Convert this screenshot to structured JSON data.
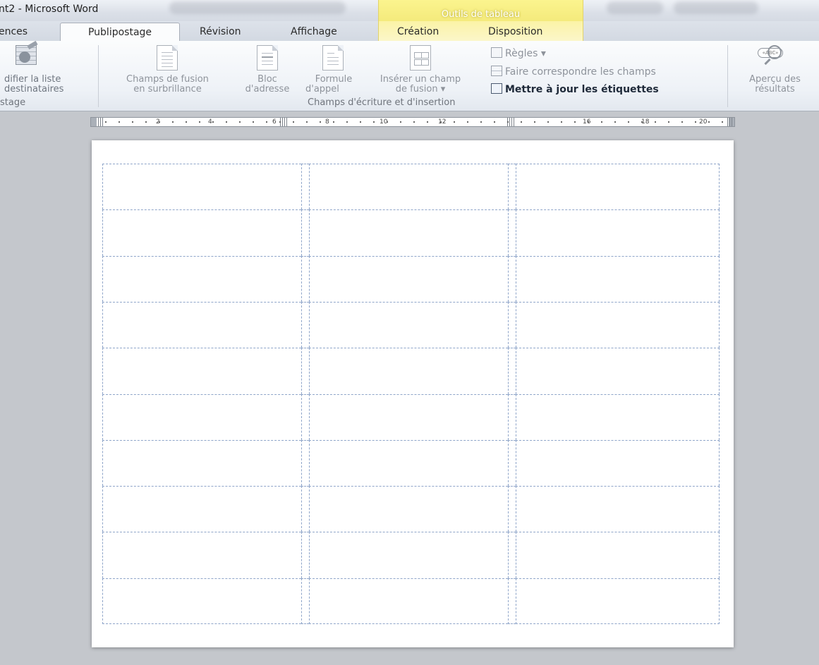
{
  "window": {
    "title": "nt2 - Microsoft Word",
    "context_tool_title": "Outils de tableau",
    "accent_context": "#f7ee82"
  },
  "tabs": {
    "references": "ences",
    "mailings": "Publipostage",
    "review": "Révision",
    "view": "Affichage",
    "design": "Création",
    "layout": "Disposition"
  },
  "ribbon": {
    "edit_list": {
      "line1": "difier la liste",
      "line2": "destinataires"
    },
    "start_group_label": "stage",
    "highlight_fields": {
      "line1": "Champs de fusion",
      "line2": "en surbrillance"
    },
    "address_block": {
      "line1": "Bloc",
      "line2": "d'adresse"
    },
    "greeting_line": {
      "line1": "Formule",
      "line2": "d'appel"
    },
    "insert_field": {
      "line1": "Insérer un champ",
      "line2": "de fusion ▾"
    },
    "rules": "Règles ▾",
    "match_fields": "Faire correspondre les champs",
    "update_labels": "Mettre à jour les étiquettes",
    "write_group_label": "Champs d'écriture et d'insertion",
    "preview": {
      "line1": "Aperçu des",
      "line2": "résultats",
      "icon_text": "«ABC»"
    }
  },
  "ruler": {
    "numbers": [
      "2",
      "4",
      "6",
      "8",
      "10",
      "12",
      "16",
      "18",
      "20"
    ]
  },
  "document": {
    "label_rows": 10,
    "label_columns": 3
  }
}
